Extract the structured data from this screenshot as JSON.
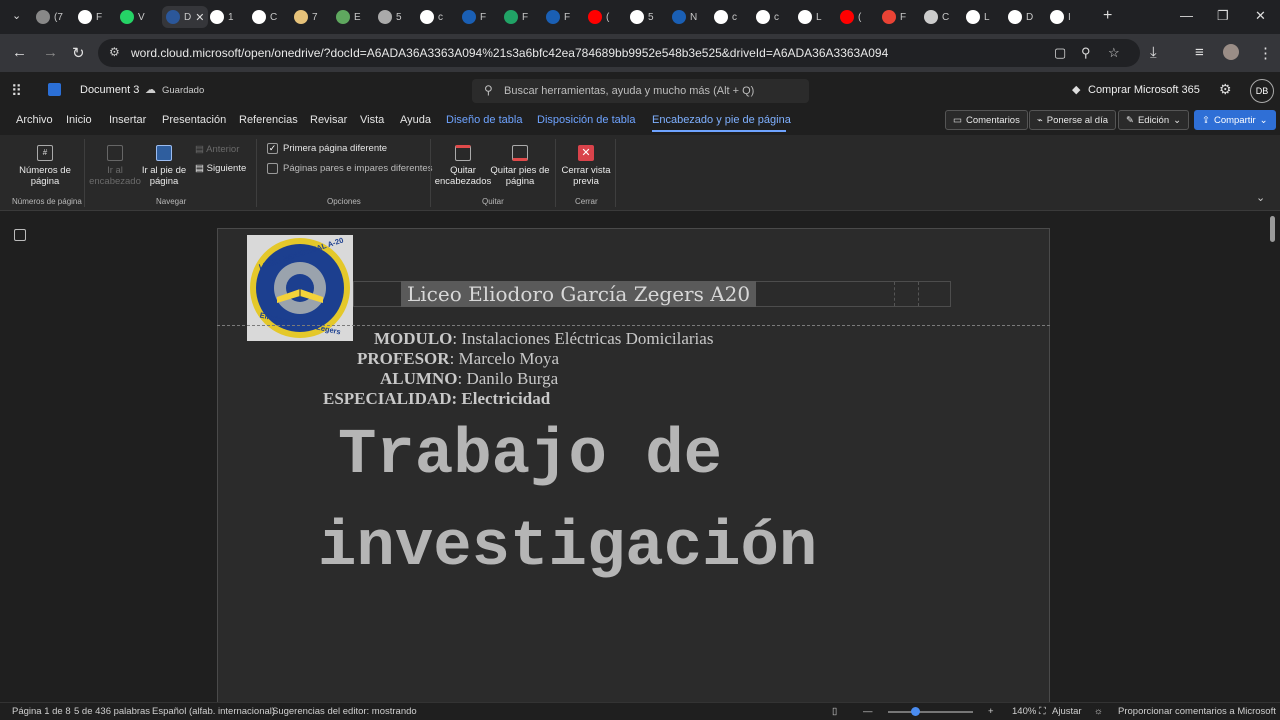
{
  "browser": {
    "tabs": [
      {
        "label": "(7",
        "color": "#888888"
      },
      {
        "label": "F",
        "color": "#ffffff"
      },
      {
        "label": "V",
        "color": "#25d366"
      },
      {
        "label": "D",
        "color": "#2b579a"
      },
      {
        "label": "1",
        "color": "#ffffff"
      },
      {
        "label": "C",
        "color": "#ffffff"
      },
      {
        "label": "7",
        "color": "#e6c27a"
      },
      {
        "label": "E",
        "color": "#5fa85f"
      },
      {
        "label": "5",
        "color": "#aaaaaa"
      },
      {
        "label": "c",
        "color": "#ffffff"
      },
      {
        "label": "F",
        "color": "#1a5fb4"
      },
      {
        "label": "F",
        "color": "#21a366"
      },
      {
        "label": "F",
        "color": "#1a5fb4"
      },
      {
        "label": "(",
        "color": "#ff0000"
      },
      {
        "label": "5",
        "color": "#ffffff"
      },
      {
        "label": "N",
        "color": "#1a5fb4"
      },
      {
        "label": "c",
        "color": "#ffffff"
      },
      {
        "label": "c",
        "color": "#ffffff"
      },
      {
        "label": "L",
        "color": "#ffffff"
      },
      {
        "label": "(",
        "color": "#ff0000"
      },
      {
        "label": "F",
        "color": "#ea4335"
      },
      {
        "label": "C",
        "color": "#cccccc"
      },
      {
        "label": "L",
        "color": "#ffffff"
      },
      {
        "label": "D",
        "color": "#ffffff"
      },
      {
        "label": "I",
        "color": "#ffffff"
      }
    ],
    "active_tab_label": "D",
    "new_tab": "+",
    "url": "word.cloud.microsoft/open/onedrive/?docId=A6ADA36A3363A094%21s3a6bfc42ea784689bb9952e548b3e525&driveId=A6ADA36A3363A094"
  },
  "app": {
    "doc_title": "Document 3",
    "save_status": "Guardado",
    "search_placeholder": "Buscar herramientas, ayuda y mucho más (Alt + Q)",
    "buy_label": "Comprar Microsoft 365",
    "avatar_initials": "DB"
  },
  "ribbon_tabs": [
    "Archivo",
    "Inicio",
    "Insertar",
    "Presentación",
    "Referencias",
    "Revisar",
    "Vista",
    "Ayuda",
    "Diseño de tabla",
    "Disposición de tabla",
    "Encabezado y pie de página"
  ],
  "top_buttons": {
    "comments": "Comentarios",
    "catch_up": "Ponerse al día",
    "editing": "Edición",
    "share": "Compartir"
  },
  "ribbon": {
    "page_numbers": "Números de página",
    "group_page_numbers": "Números de página",
    "go_header": "Ir al encabezado",
    "go_footer": "Ir al pie de página",
    "previous": "Anterior",
    "next": "Siguiente",
    "group_navigate": "Navegar",
    "different_first": "Primera página diferente",
    "different_odd_even": "Páginas pares e impares diferentes",
    "group_options": "Opciones",
    "remove_headers": "Quitar encabezados",
    "remove_footers": "Quitar pies de página",
    "group_remove": "Quitar",
    "close_preview": "Cerrar vista previa",
    "group_close": "Cerrar"
  },
  "document": {
    "header_title": "Liceo Eliodoro García Zegers A20",
    "logo_text_top": "LICEO INDUSTRIAL A-20",
    "logo_text_bottom": "Eliodoro García Zegers",
    "info": [
      {
        "key": "MODULO",
        "value": "Instalaciones Eléctricas Domicilarias"
      },
      {
        "key": "PROFESOR",
        "value": "Marcelo Moya"
      },
      {
        "key": "ALUMNO",
        "value": "Danilo Burga"
      },
      {
        "key": "ESPECIALIDAD:",
        "value": "Electricidad"
      }
    ],
    "title_line1": "Trabajo de",
    "title_line2": "investigación"
  },
  "status": {
    "page": "Página 1 de 8",
    "words": "5 de 436 palabras",
    "language": "Español (alfab. internacional)",
    "editor": "Sugerencias del editor: mostrando",
    "zoom": "140%",
    "fit": "Ajustar",
    "feedback": "Proporcionar comentarios a Microsoft"
  }
}
